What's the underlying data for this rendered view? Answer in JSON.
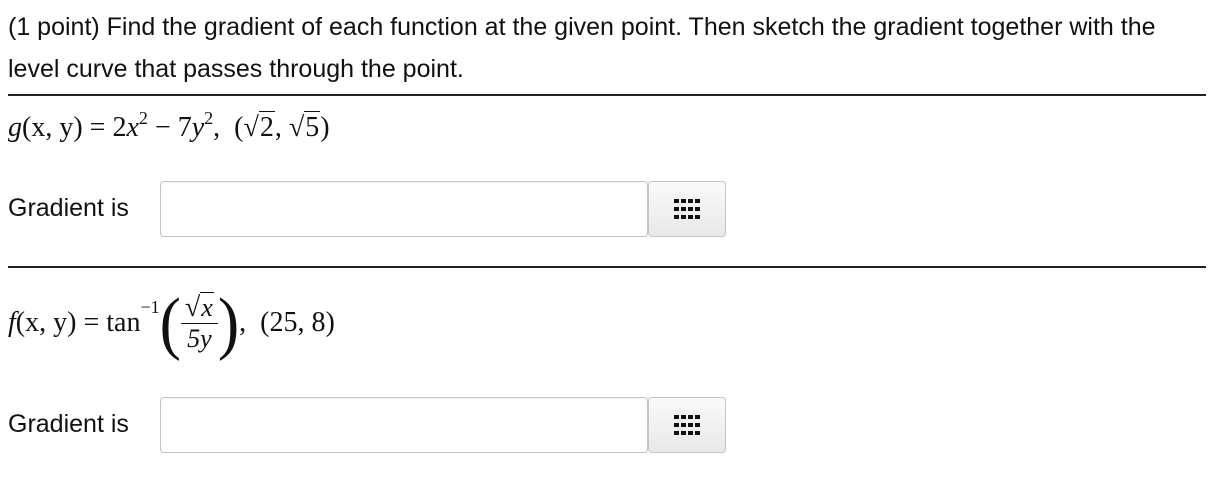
{
  "problem": {
    "intro": "(1 point) Find the gradient of each function at the given point. Then sketch the gradient together with the level curve that passes through the point."
  },
  "part1": {
    "fn_name": "g",
    "fn_args": "(x, y)",
    "equals": "=",
    "term1_coef": "2",
    "term1_var": "x",
    "term1_exp": "2",
    "minus": "−",
    "term2_coef": "7",
    "term2_var": "y",
    "term2_exp": "2",
    "comma": ",",
    "point_open": "(",
    "point_a": "2",
    "point_sep": ", ",
    "point_b": "5",
    "point_close": ")",
    "answer_label": "Gradient is",
    "answer_value": ""
  },
  "part2": {
    "fn_name": "f",
    "fn_args": "(x, y)",
    "equals": "=",
    "func": "tan",
    "func_exp": "−1",
    "num_var": "x",
    "den": "5y",
    "comma": ",",
    "point": "(25, 8)",
    "answer_label": "Gradient is",
    "answer_value": ""
  },
  "palette_icon": "grid-dots-icon"
}
